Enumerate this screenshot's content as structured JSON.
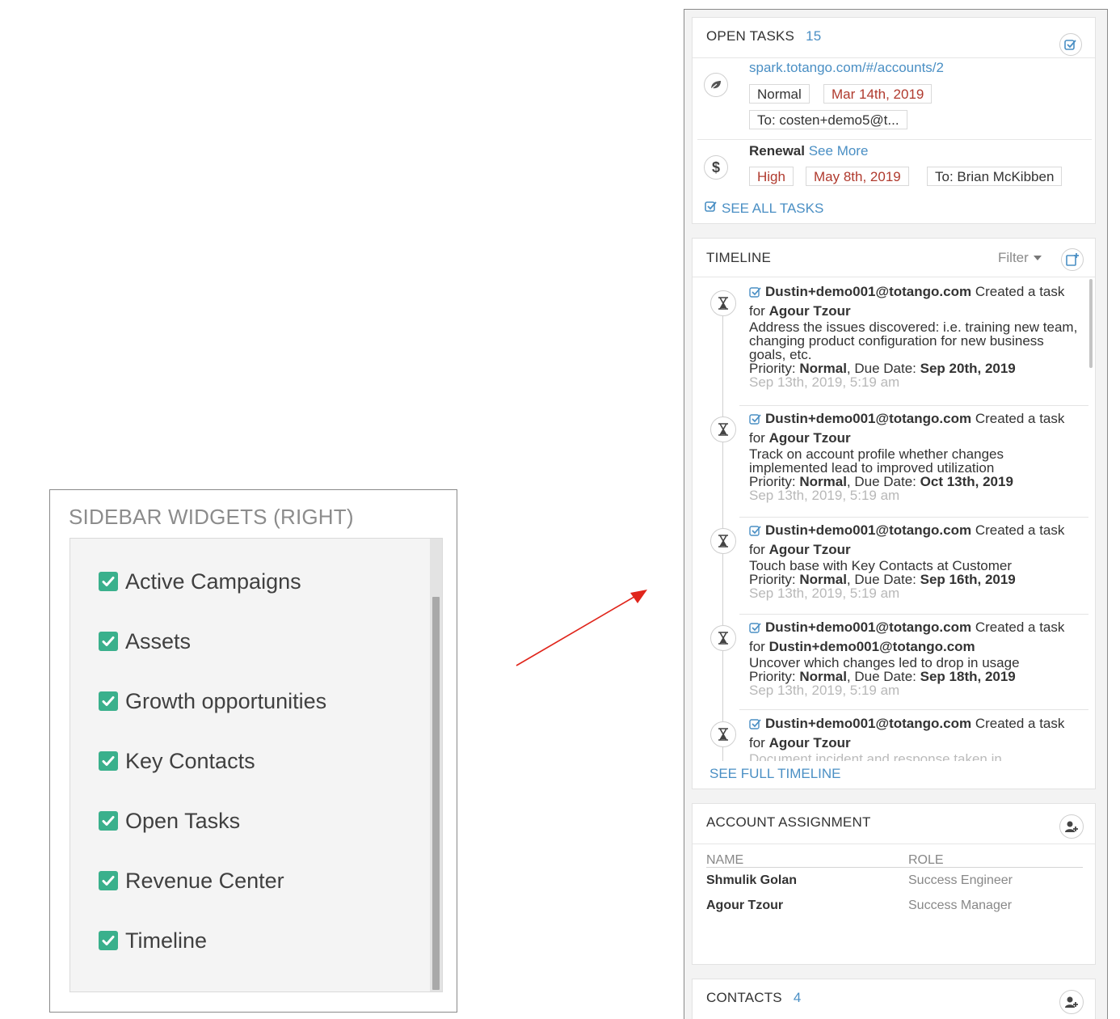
{
  "sidebar_widgets": {
    "title": "SIDEBAR WIDGETS (RIGHT)",
    "check_color": "#3ab08c",
    "items": [
      {
        "label": "Active Campaigns",
        "checked": true
      },
      {
        "label": "Assets",
        "checked": true
      },
      {
        "label": "Growth opportunities",
        "checked": true
      },
      {
        "label": "Key Contacts",
        "checked": true
      },
      {
        "label": "Open Tasks",
        "checked": true
      },
      {
        "label": "Revenue Center",
        "checked": true
      },
      {
        "label": "Timeline",
        "checked": true
      }
    ]
  },
  "open_tasks": {
    "title": "OPEN TASKS",
    "count": "15",
    "task1": {
      "icon": "leaf-icon",
      "link": "spark.totango.com/#/accounts/2",
      "priority": "Normal",
      "due": "Mar 14th, 2019",
      "assignee": "To: costen+demo5@t..."
    },
    "task2": {
      "icon": "dollar-icon",
      "name": "Renewal",
      "see_more": "See More",
      "priority": "High",
      "due": "May 8th, 2019",
      "assignee": "To: Brian McKibben"
    },
    "see_all": "SEE ALL TASKS"
  },
  "timeline": {
    "title": "TIMELINE",
    "filter": "Filter",
    "entries": [
      {
        "author": "Dustin+demo001@totango.com",
        "action": " Created a task for ",
        "target": "Agour Tzour",
        "desc": "Address the issues discovered: i.e. training new team, changing product configuration for new business goals, etc.",
        "priority_label": "Priority: ",
        "priority": "Normal",
        "due_label": ", Due Date: ",
        "due": "Sep 20th, 2019",
        "date": "Sep 13th, 2019, 5:19 am"
      },
      {
        "author": "Dustin+demo001@totango.com",
        "action": " Created a task for ",
        "target": "Agour Tzour",
        "desc": "Track on account profile whether changes implemented lead to improved utilization",
        "priority_label": "Priority: ",
        "priority": "Normal",
        "due_label": ", Due Date: ",
        "due": "Oct 13th, 2019",
        "date": "Sep 13th, 2019, 5:19 am"
      },
      {
        "author": "Dustin+demo001@totango.com",
        "action": " Created a task for ",
        "target": "Agour Tzour",
        "desc": "Touch base with Key Contacts at Customer",
        "priority_label": "Priority: ",
        "priority": "Normal",
        "due_label": ", Due Date: ",
        "due": "Sep 16th, 2019",
        "date": "Sep 13th, 2019, 5:19 am"
      },
      {
        "author": "Dustin+demo001@totango.com",
        "action": " Created a task for ",
        "target": "Dustin+demo001@totango.com",
        "desc": "Uncover which changes led to drop in usage",
        "priority_label": "Priority: ",
        "priority": "Normal",
        "due_label": ", Due Date: ",
        "due": "Sep 18th, 2019",
        "date": "Sep 13th, 2019, 5:19 am"
      },
      {
        "author": "Dustin+demo001@totango.com",
        "action": " Created a task for ",
        "target": "Agour Tzour",
        "desc": "Document incident and response taken in",
        "priority_label": "",
        "priority": "",
        "due_label": "",
        "due": "",
        "date": ""
      }
    ],
    "see_full": "SEE FULL TIMELINE"
  },
  "account_assignment": {
    "title": "ACCOUNT ASSIGNMENT",
    "col_name": "NAME",
    "col_role": "ROLE",
    "rows": [
      {
        "name": "Shmulik Golan",
        "role": "Success Engineer"
      },
      {
        "name": "Agour Tzour",
        "role": "Success Manager"
      }
    ]
  },
  "contacts": {
    "title": "CONTACTS",
    "count": "4"
  },
  "colors": {
    "link": "#4a8fc4",
    "tag_red": "#b03a2e",
    "arrow": "#e0251b"
  }
}
